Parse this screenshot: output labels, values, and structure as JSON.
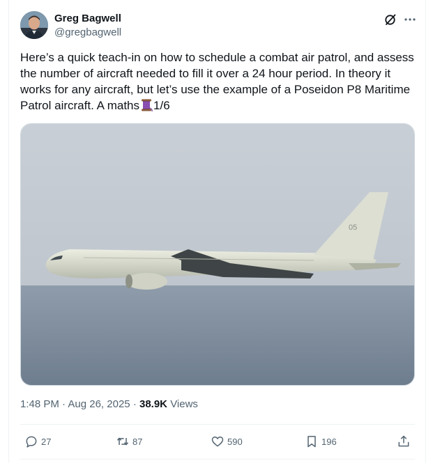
{
  "author": {
    "name": "Greg Bagwell",
    "handle": "@gregbagwell"
  },
  "tweet": {
    "text": "Here’s a quick teach-in on how to schedule a combat air patrol, and assess the number of aircraft needed to fill it over a 24 hour period. In theory it works for any aircraft, but let’s use the example of a Poseidon P8 Maritime Patrol aircraft. A maths",
    "thread_marker": "1/6",
    "emoji": "thread-spool-icon",
    "media": {
      "tail_number": "05"
    }
  },
  "meta": {
    "time": "1:48 PM",
    "separator": "·",
    "date": "Aug 26, 2025",
    "views_count": "38.9K",
    "views_label": "Views"
  },
  "actions": {
    "replies": "27",
    "reposts": "87",
    "likes": "590",
    "bookmarks": "196"
  },
  "icons": [
    "grok-icon",
    "more-icon",
    "reply-icon",
    "repost-icon",
    "like-icon",
    "bookmark-icon",
    "share-icon"
  ],
  "colors": {
    "text_primary": "#0f1419",
    "text_secondary": "#536471",
    "border": "#eff3f4"
  }
}
